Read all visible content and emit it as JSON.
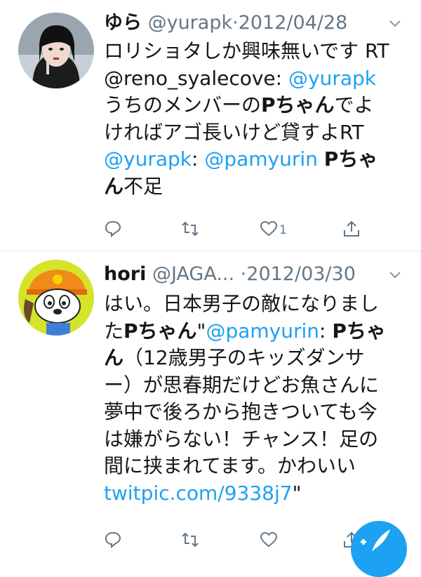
{
  "tweets": [
    {
      "name": "ゆら",
      "handle": "@yurapk",
      "dot": "·",
      "date": "2012/04/28",
      "body": [
        {
          "t": "ロリショタしか興味無いです RT ",
          "c": ""
        },
        {
          "t": "@reno_syalecove",
          "c": ""
        },
        {
          "t": ": ",
          "c": ""
        },
        {
          "t": "@yurapk",
          "c": "link"
        },
        {
          "t": " うちのメンバーの",
          "c": ""
        },
        {
          "t": "Pちゃん",
          "c": "bold"
        },
        {
          "t": "でよければアゴ長いけど貸すよRT ",
          "c": ""
        },
        {
          "t": "@yurapk",
          "c": "link"
        },
        {
          "t": ": ",
          "c": ""
        },
        {
          "t": "@pamyurin",
          "c": "link"
        },
        {
          "t": " ",
          "c": ""
        },
        {
          "t": "Pちゃん",
          "c": "bold"
        },
        {
          "t": "不足",
          "c": ""
        }
      ],
      "actions": {
        "reply": "",
        "retweet": "",
        "like": "1",
        "share": ""
      }
    },
    {
      "name": "hori",
      "handle": "@JAGA...",
      "dot": " ·",
      "date": "2012/03/30",
      "body": [
        {
          "t": "はい。日本男子の敵になりました",
          "c": ""
        },
        {
          "t": "Pちゃん",
          "c": "bold"
        },
        {
          "t": "\"",
          "c": ""
        },
        {
          "t": "@pamyurin",
          "c": "link"
        },
        {
          "t": ": ",
          "c": ""
        },
        {
          "t": "Pちゃん",
          "c": "bold"
        },
        {
          "t": "（12歳男子のキッズダンサー）が思春期だけどお魚さんに夢中で後ろから抱きついても今は嫌がらない！チャンス！足の間に挟まれてます。かわいい ",
          "c": ""
        },
        {
          "t": "twitpic.com/9338j7",
          "c": "link"
        },
        {
          "t": "\"",
          "c": ""
        }
      ],
      "actions": {
        "reply": "",
        "retweet": "",
        "like": "",
        "share": ""
      }
    }
  ],
  "colors": {
    "link": "#1da1f2",
    "meta": "#657786",
    "fab": "#1da1f2"
  },
  "icons": [
    "reply-icon",
    "retweet-icon",
    "like-icon",
    "share-icon",
    "chevron-down-icon",
    "compose-icon"
  ]
}
